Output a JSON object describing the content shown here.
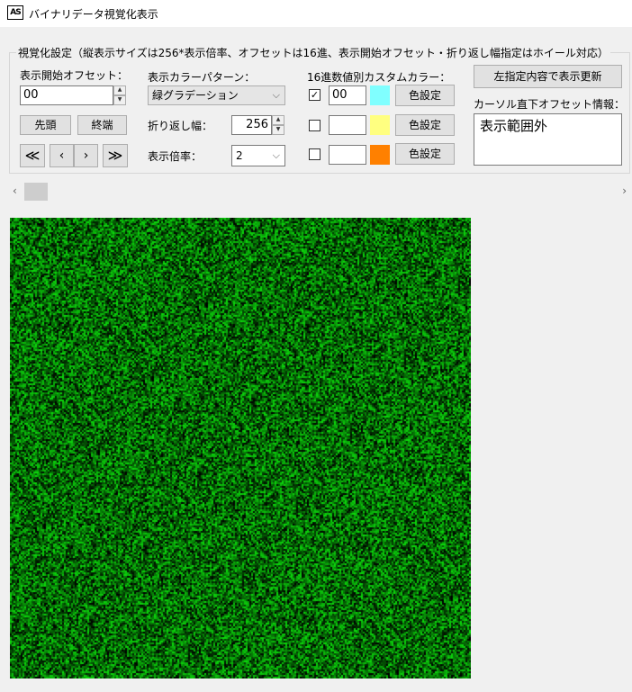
{
  "window": {
    "icon_text": "AS",
    "title": "バイナリデータ視覚化表示"
  },
  "settings": {
    "caption": "視覚化設定（縦表示サイズは256*表示倍率、オフセットは16進、表示開始オフセット・折り返し幅指定はホイール対応）",
    "start_offset_label": "表示開始オフセット：",
    "start_offset_value": "00",
    "head_button": "先頭",
    "end_button": "終端",
    "nav_buttons": [
      "≪",
      "‹",
      "›",
      "≫"
    ],
    "color_pattern_label": "表示カラーパターン：",
    "color_pattern_value": "緑グラデーション",
    "wrap_width_label": "折り返し幅：",
    "wrap_width_value": "256",
    "scale_label": "表示倍率：",
    "scale_value": "2",
    "custom_color_label": "16進数値別カスタムカラー：",
    "custom_colors": [
      {
        "checked": true,
        "hex": "00",
        "color": "#80ffff",
        "button": "色設定"
      },
      {
        "checked": false,
        "hex": "",
        "color": "#ffff80",
        "button": "色設定"
      },
      {
        "checked": false,
        "hex": "",
        "color": "#ff8000",
        "button": "色設定"
      }
    ],
    "refresh_button": "左指定内容で表示更新",
    "cursor_info_label": "カーソル直下オフセット情報：",
    "cursor_info_value": "表示範囲外"
  },
  "scrollbar": {
    "left_arrow": "‹",
    "right_arrow": "›"
  },
  "visualization": {
    "palette": "green-gradient",
    "base_color": "#00cc00"
  }
}
